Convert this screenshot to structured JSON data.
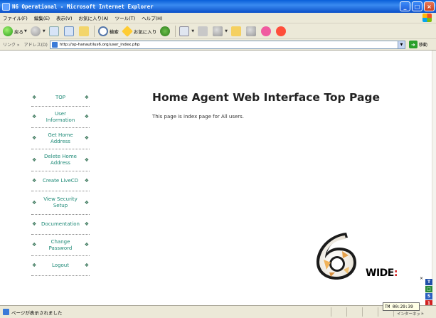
{
  "window": {
    "title": "N6 Operational - Microsoft Internet Explorer"
  },
  "menubar": {
    "items": [
      "ファイル(F)",
      "編集(E)",
      "表示(V)",
      "お気に入り(A)",
      "ツール(T)",
      "ヘルプ(H)"
    ]
  },
  "toolbar": {
    "back_label": "戻る",
    "search_label": "検索",
    "favorites_label": "お気に入り"
  },
  "address": {
    "links_label": "リンク »",
    "label": "アドレス(D)",
    "value": "http://op-hanautilus6.org/user_index.php",
    "go_label": "移動"
  },
  "sidebar": {
    "items": [
      {
        "label": "TOP"
      },
      {
        "label": "User Information"
      },
      {
        "label": "Get Home Address"
      },
      {
        "label": "Delete Home Address"
      },
      {
        "label": "Create LiveCD"
      },
      {
        "label": "View Security Setup"
      },
      {
        "label": "Documentation"
      },
      {
        "label": "Change Password"
      },
      {
        "label": "Logout"
      }
    ]
  },
  "main": {
    "title": "Home Agent Web Interface Top Page",
    "text": "This page is index page for All users."
  },
  "logo": {
    "wide_text": "WID",
    "wide_e": "E"
  },
  "status": {
    "text": "ページが表示されました",
    "clock": "TM 00:29:39",
    "zone": "インターネット"
  },
  "tray": {
    "icons": [
      "T",
      "□",
      "S",
      "1"
    ],
    "close": "×"
  },
  "colors": {
    "nav_link": "#1e8a77",
    "title_text": "#222222",
    "titlebar": "#0a5fd8"
  }
}
